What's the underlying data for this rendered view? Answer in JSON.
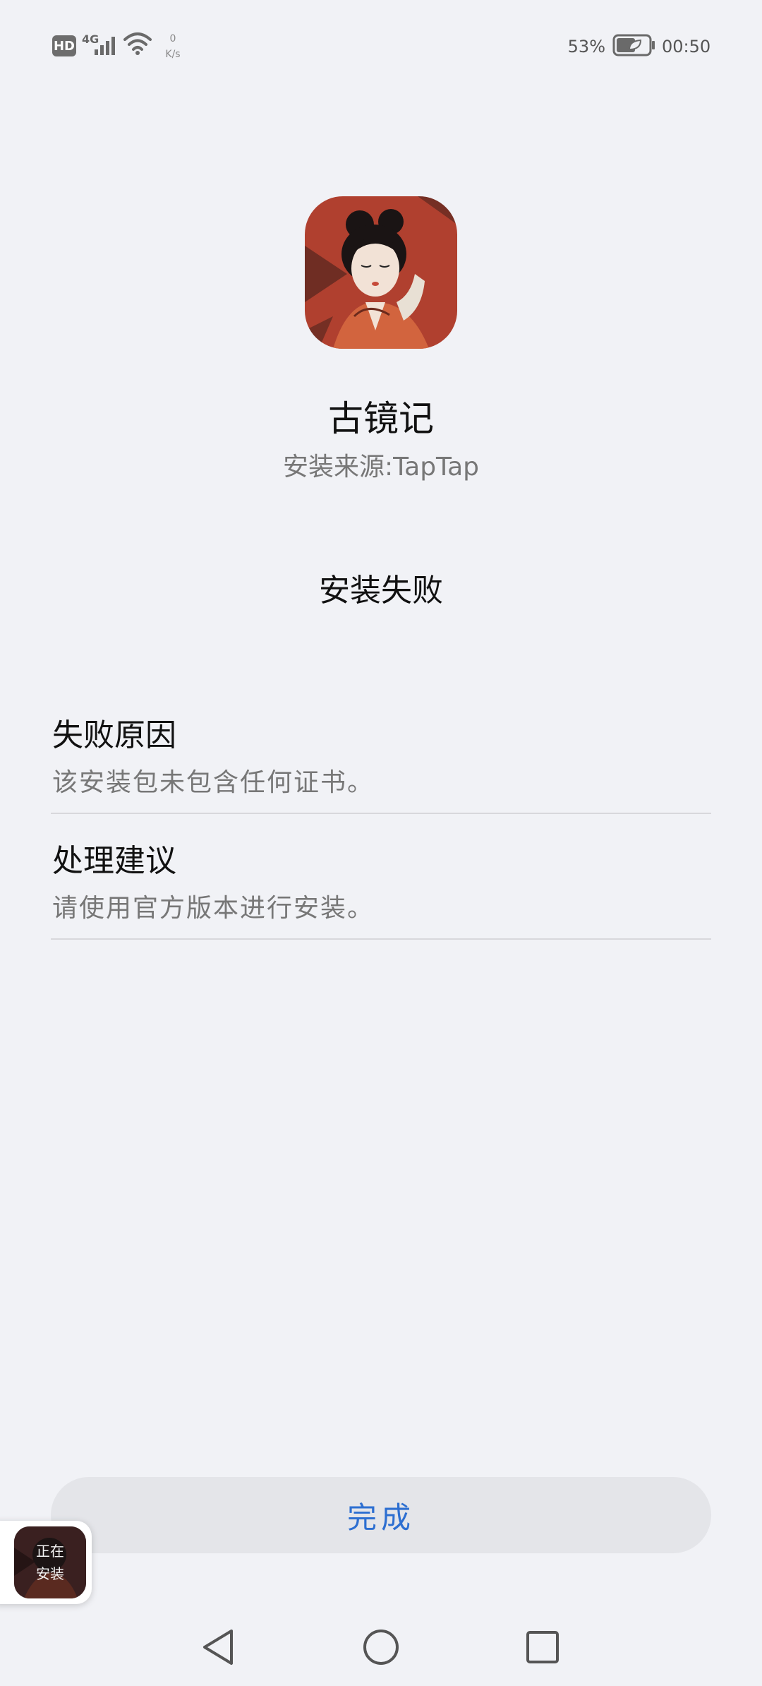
{
  "status_bar": {
    "hd_label": "HD",
    "network_gen": "4G",
    "speed_value": "0",
    "speed_unit": "K/s",
    "battery_percent": "53%",
    "time": "00:50"
  },
  "app": {
    "name": "古镜记",
    "source": "安装来源:TapTap"
  },
  "status": {
    "title": "安装失败"
  },
  "failure_reason": {
    "title": "失败原因",
    "text": "该安装包未包含任何证书。"
  },
  "suggestion": {
    "title": "处理建议",
    "text": "请使用官方版本进行安装。"
  },
  "done_button": {
    "label": "完成"
  },
  "installing_badge": {
    "label": "正在\n安装"
  },
  "icons": {
    "signal": "signal-icon",
    "wifi": "wifi-icon",
    "battery": "battery-icon",
    "back": "back-icon",
    "home": "home-icon",
    "recent": "recent-apps-icon"
  },
  "colors": {
    "background": "#f1f2f6",
    "accent": "#2d6fd1"
  }
}
